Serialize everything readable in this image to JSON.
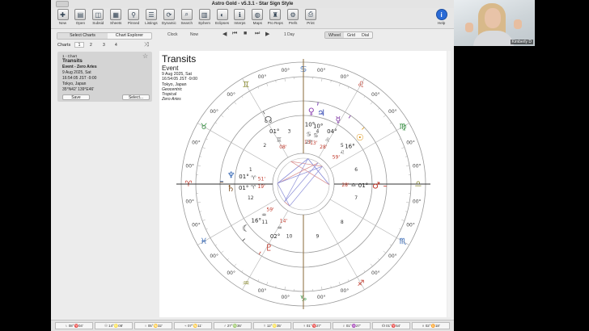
{
  "app": {
    "title": "Astro Gold - v5.3.1 - Star Sign Style"
  },
  "toolbar": [
    {
      "label": "New",
      "icon": "new-doc-icon",
      "glyph": "✚"
    },
    {
      "label": "Open",
      "icon": "open-folder-icon",
      "glyph": "▤"
    },
    {
      "label": "Subsid",
      "icon": "subsid-icon",
      "glyph": "◫"
    },
    {
      "label": "Sheets",
      "icon": "sheets-icon",
      "glyph": "▦"
    },
    {
      "label": "Pinned",
      "icon": "pin-icon",
      "glyph": "⚲"
    },
    {
      "label": "Listings",
      "icon": "list-icon",
      "glyph": "☰"
    },
    {
      "label": "Dynamic",
      "icon": "dynamic-icon",
      "glyph": "⟳"
    },
    {
      "label": "Search",
      "icon": "search-icon",
      "glyph": "⌕"
    },
    {
      "label": "Ephem",
      "icon": "ephemeris-icon",
      "glyph": "▥"
    },
    {
      "label": "Eclipses",
      "icon": "eclipse-icon",
      "glyph": "◐"
    },
    {
      "label": "Interps",
      "icon": "interpretations-icon",
      "glyph": "ℹ"
    },
    {
      "label": "Maps",
      "icon": "globe-icon",
      "glyph": "◍"
    },
    {
      "label": "Pro Reps",
      "icon": "reports-icon",
      "glyph": "♜"
    },
    {
      "label": "Prefs",
      "icon": "gear-icon",
      "glyph": "⚙"
    },
    {
      "label": "Print",
      "icon": "printer-icon",
      "glyph": "⎙"
    },
    {
      "label": "Help",
      "icon": "help-icon",
      "glyph": "i"
    }
  ],
  "nav": {
    "clock": "Clock",
    "now": "Now",
    "interval": "1 Day",
    "views": [
      "Wheel",
      "Grid",
      "Dial"
    ],
    "active_view": "Wheel"
  },
  "sidebar": {
    "tabs": [
      "Select Charts",
      "Chart Explorer"
    ],
    "charts_label": "Charts",
    "chart_numbers": [
      "1",
      "2",
      "3",
      "4"
    ],
    "chart_card": {
      "slot": "1 - Chart",
      "title": "Transits",
      "subtitle": "Event - Zero Aries",
      "date": "9 Aug 2025, Sat",
      "time": "16:54:05 JST -9:00",
      "place": "Tokyo, Japan",
      "coords": "35°N42' 139°E46'",
      "save": "Save",
      "select": "Select..."
    }
  },
  "chart_info": {
    "title": "Transits",
    "type": "Event",
    "date": "9 Aug 2025, Sat",
    "time": "16:54:05 JST -9:00",
    "place": "Tokyo, Japan",
    "zodiac": "Geocentric",
    "tropical": "Tropical",
    "house": "Zero Aries"
  },
  "wheel": {
    "colors": {
      "fire": "#c0392b",
      "earth": "#2e8b3a",
      "air": "#8a8a2e",
      "water": "#2a5fb0",
      "aspect_blue": "#8c8fd8",
      "aspect_red": "#d98c8c"
    },
    "signs": [
      {
        "name": "aries",
        "glyph": "♈",
        "element": "fire"
      },
      {
        "name": "taurus",
        "glyph": "♉",
        "element": "earth"
      },
      {
        "name": "gemini",
        "glyph": "♊",
        "element": "air"
      },
      {
        "name": "cancer",
        "glyph": "♋",
        "element": "water"
      },
      {
        "name": "leo",
        "glyph": "♌",
        "element": "fire"
      },
      {
        "name": "virgo",
        "glyph": "♍",
        "element": "earth"
      },
      {
        "name": "libra",
        "glyph": "♎",
        "element": "air"
      },
      {
        "name": "scorpio",
        "glyph": "♏",
        "element": "water"
      },
      {
        "name": "sagittarius",
        "glyph": "♐",
        "element": "fire"
      },
      {
        "name": "capricorn",
        "glyph": "♑",
        "element": "earth"
      },
      {
        "name": "aquarius",
        "glyph": "♒",
        "element": "air"
      },
      {
        "name": "pisces",
        "glyph": "♓",
        "element": "water"
      }
    ],
    "cusp_degree": "00°",
    "house_numbers": [
      "1",
      "2",
      "3",
      "4",
      "5",
      "6",
      "7",
      "8",
      "9",
      "10",
      "11",
      "12"
    ],
    "planets": [
      {
        "name": "pluto",
        "glyph": "♇",
        "degree": "02°",
        "sign": "♒",
        "minutes": "14'",
        "lon": 302.2,
        "color": "#c0392b"
      },
      {
        "name": "moon",
        "glyph": "☾",
        "degree": "16°",
        "sign": "♒",
        "minutes": "59'",
        "lon": 316.9,
        "color": "#222222"
      },
      {
        "name": "saturn",
        "glyph": "♄",
        "degree": "01°",
        "sign": "♈",
        "minutes": "19'",
        "lon": 1.3,
        "color": "#7a4a1a"
      },
      {
        "name": "neptune",
        "glyph": "♆",
        "degree": "01°",
        "sign": "♈",
        "minutes": "51'",
        "lon": 1.8,
        "color": "#2a5fb0"
      },
      {
        "name": "jupiter",
        "glyph": "♃",
        "degree": "10°",
        "sign": "♋",
        "minutes": "13'",
        "lon": 100.2,
        "color": "#2a3fb0"
      },
      {
        "name": "venus",
        "glyph": "♀",
        "degree": "10°",
        "sign": "♋",
        "minutes": "13'",
        "lon": 100.2,
        "color": "#8a3fb0"
      },
      {
        "name": "north-node",
        "glyph": "☊",
        "degree": "01°",
        "sign": "♊",
        "minutes": "08'",
        "lon": 61.1,
        "color": "#555555"
      },
      {
        "name": "mercury",
        "glyph": "☿",
        "degree": "04°",
        "sign": "♌",
        "minutes": "28'",
        "lon": 124.5,
        "color": "#7a2fa0"
      },
      {
        "name": "sun",
        "glyph": "☉",
        "degree": "16°",
        "sign": "♌",
        "minutes": "59'",
        "lon": 136.9,
        "color": "#d98a00"
      },
      {
        "name": "mars",
        "glyph": "♂",
        "degree": "01°",
        "sign": "♎",
        "minutes": "28'",
        "lon": 181.5,
        "color": "#c0392b"
      }
    ],
    "extra_minutes": "27'",
    "axis_labels": {
      "asc_deg": "00°",
      "dsc_deg": "00°"
    }
  },
  "bottom_bar": [
    "♄ 08°♈04'",
    "☉ 14°♌08'",
    "♀ 05°♋32'",
    "♃ 07°♋11'",
    "♂ 27°♍36'",
    "☿ 12°♌35'",
    "♆ 01°♈27'",
    "♇ 01°♒27'",
    "☊ 01°♈54'",
    "♅ 02°♊18'"
  ],
  "video": {
    "name": "Kimberly D"
  }
}
